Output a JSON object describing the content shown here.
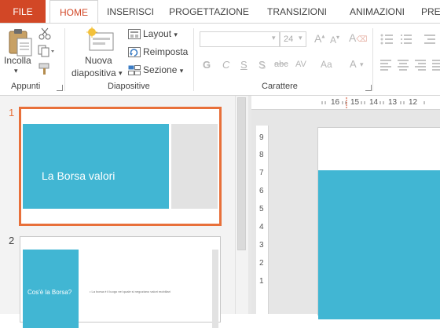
{
  "tabs": [
    "FILE",
    "HOME",
    "INSERISCI",
    "PROGETTAZIONE",
    "TRANSIZIONI",
    "ANIMAZIONI",
    "PRE"
  ],
  "clipboard": {
    "paste": "Incolla",
    "group": "Appunti"
  },
  "slides_group": {
    "new_slide_line1": "Nuova",
    "new_slide_line2": "diapositiva",
    "layout": "Layout",
    "reset": "Reimposta",
    "section": "Sezione",
    "group": "Diapositive"
  },
  "font_group": {
    "font_size": "24",
    "bold": "G",
    "italic": "C",
    "underline": "S",
    "shadow": "S",
    "strike": "abc",
    "spacing": "AV",
    "case": "Aa",
    "color": "A",
    "group": "Carattere"
  },
  "thumbnails": [
    {
      "number": "1",
      "title": "La Borsa valori"
    },
    {
      "number": "2",
      "title": "Cos'è la Borsa?",
      "bullet": "La borsa è il luogo nel quale si negoziano valori mobiliari"
    }
  ],
  "ruler": {
    "h": [
      "16",
      "15",
      "14",
      "13",
      "12"
    ],
    "v": [
      "9",
      "8",
      "7",
      "6",
      "5",
      "4",
      "3",
      "2",
      "1"
    ]
  },
  "colors": {
    "accent": "#d24726",
    "slide_blue": "#41b6d3",
    "slide_gray": "#e2e2e2",
    "selection": "#e8703a"
  }
}
